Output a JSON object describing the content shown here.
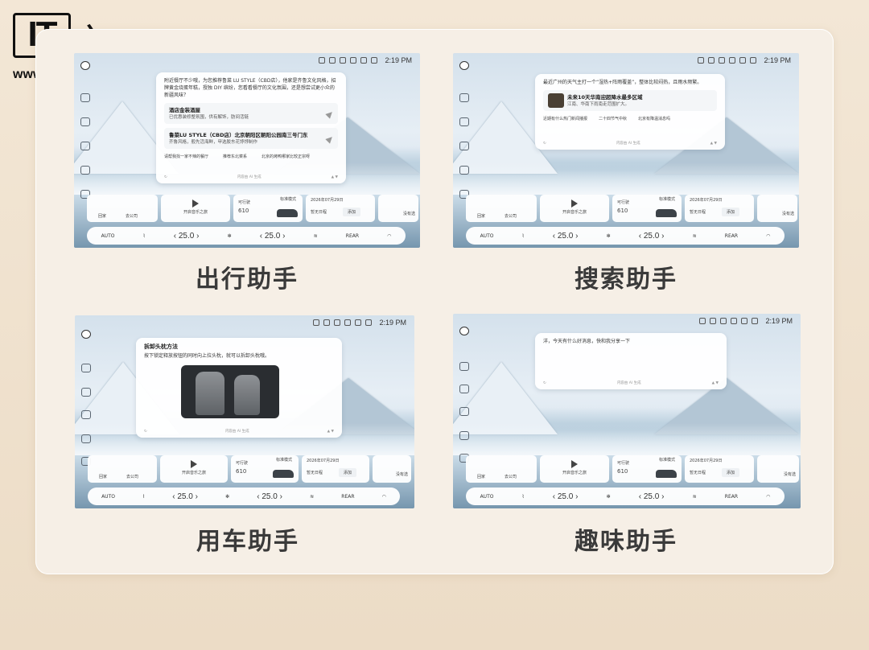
{
  "brand": {
    "logo_mark": "IT",
    "logo_cn": "之家",
    "url": "www.ithome.com"
  },
  "common": {
    "time": "2:19 PM",
    "dock": {
      "home": "回家",
      "company": "去公司",
      "music": "开启音乐之旅",
      "mode": "标准模式",
      "range_label": "可行驶",
      "range": "610",
      "range_unit": "km",
      "date": "2026年07月29日",
      "schedule": "暂无日程",
      "add": "添加",
      "more": "没有选"
    },
    "climate": {
      "auto": "AUTO",
      "temp_left": "25.0",
      "temp_right": "25.0",
      "rear": "REAR"
    },
    "feedback": "内容由 AI 生成"
  },
  "panels": [
    {
      "caption": "出行助手",
      "intro": "附近餐厅不少哦，为您推荐鲁菜 LU STYLE（CBD店），他家是齐鲁文化风格，招牌黄金烧蛋年糕，授独 DIY 缤纷，您看看餐厅的文化氛围，还是想尝试更小众的新疆风味？",
      "cards": [
        {
          "title": "酒店金装酒屋",
          "sub": "已优惠装修整氛围，供有解饰，肪间活链"
        },
        {
          "title": "鲁菜LU STYLE（CBD店）北京朝阳区朝阳公园南三号门东",
          "sub": "齐鲁风格，般先活海鲜，甲选胶东花饽饽制作"
        }
      ],
      "chips": [
        "请帮我找一家不辣的餐厅",
        "推荐东北菜系",
        "北京的烤鸭哪家比较正宗呀"
      ]
    },
    {
      "caption": "搜索助手",
      "intro": "最近广州的天气主打一个“湿热+阵雨覆盖”，整体比较闷热，且雨水频繁。",
      "cards": [
        {
          "title": "未来10天华南迎超降水最多区域",
          "sub": "江南、华南下雨南走范围扩大。"
        }
      ],
      "chips": [
        "近期有什么热门新闻播报",
        "二十四节气中秋",
        "北京有降温消息吗"
      ]
    },
    {
      "caption": "用车助手",
      "title": "拆卸头枕方法",
      "intro": "按下锁定释放按钮的同时向上拉头枕，就可以拆卸头枕哦。"
    },
    {
      "caption": "趣味助手",
      "intro": "洋，今天有什么好消息，快和我分享一下"
    }
  ],
  "icons": [
    "logo-mark",
    "home-icon",
    "navigation-icon",
    "music-icon",
    "car-icon",
    "apps-icon",
    "play-icon",
    "fan-icon",
    "seat-icon",
    "defrost-icon",
    "refresh-icon",
    "like-icon",
    "dislike-icon"
  ]
}
